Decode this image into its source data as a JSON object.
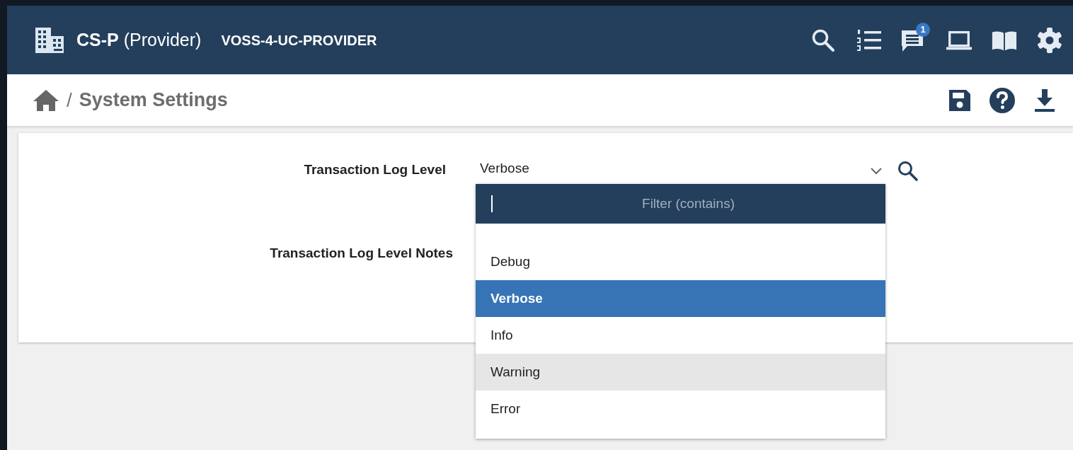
{
  "header": {
    "title": "**CS-P** (Provider)",
    "subtitle": "VOSS-4-UC-PROVIDER",
    "notification_count": "1"
  },
  "breadcrumb": {
    "separator": "/",
    "current": "System Settings"
  },
  "form": {
    "fields": [
      {
        "label": "Transaction Log Level",
        "kind": "select",
        "value": "Verbose",
        "expanded": true
      },
      {
        "label": "Transaction Log Level Notes",
        "kind": "text"
      }
    ]
  },
  "dropdown": {
    "filter": {
      "placeholder": "Filter (contains)"
    },
    "options": [
      {
        "label": "Debug",
        "selected": false,
        "hovered": false
      },
      {
        "label": "Verbose",
        "selected": true,
        "hovered": false
      },
      {
        "label": "Info",
        "selected": false,
        "hovered": false
      },
      {
        "label": "Warning",
        "selected": false,
        "hovered": true
      },
      {
        "label": "Error",
        "selected": false,
        "hovered": false
      }
    ]
  }
}
